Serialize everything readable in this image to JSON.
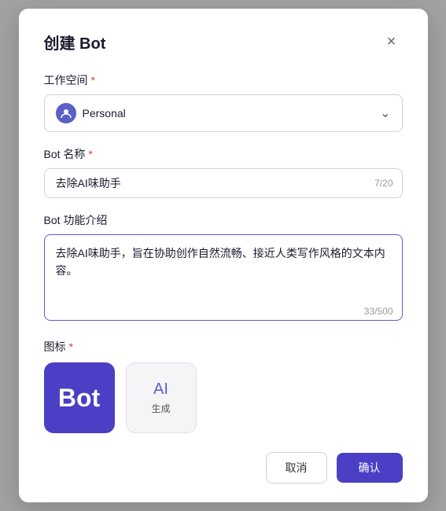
{
  "modal": {
    "title": "创建 Bot",
    "close_label": "×"
  },
  "workspace": {
    "label": "工作空间",
    "required": true,
    "value": "Personal",
    "avatar_icon": "person-icon"
  },
  "bot_name": {
    "label": "Bot 名称",
    "required": true,
    "value": "去除AI味助手",
    "char_count": "7/20"
  },
  "bot_description": {
    "label": "Bot 功能介绍",
    "required": false,
    "value": "去除AI味助手，旨在协助创作自然流畅、接近人类写作风格的文本内容。",
    "char_count": "33/500"
  },
  "icon": {
    "label": "图标",
    "required": true,
    "selected_label": "Bot",
    "generate_label": "生成",
    "generate_icon": "AI"
  },
  "footer": {
    "cancel_label": "取消",
    "confirm_label": "确认"
  }
}
